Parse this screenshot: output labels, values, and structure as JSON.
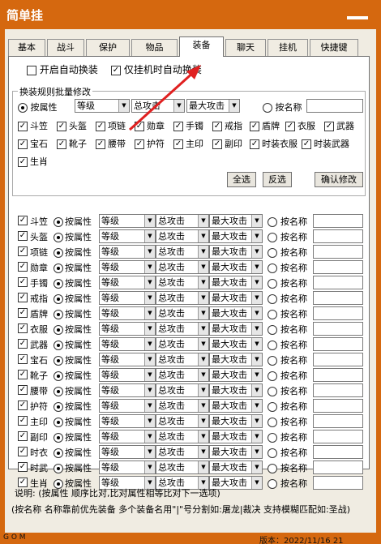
{
  "window": {
    "title": "简单挂"
  },
  "tabs": [
    {
      "label": "基本"
    },
    {
      "label": "战斗"
    },
    {
      "label": "保护"
    },
    {
      "label": "物品"
    },
    {
      "label": "装备"
    },
    {
      "label": "聊天"
    },
    {
      "label": "挂机"
    },
    {
      "label": "快捷键"
    }
  ],
  "options": {
    "auto_swap": {
      "label": "开启自动换装",
      "checked": false
    },
    "swap_on_idle": {
      "label": "仅挂机时自动换装",
      "checked": true
    }
  },
  "batch": {
    "title": "换装规则批量修改",
    "by_attr_label": "按属性",
    "attr_value": "等级",
    "attack_value": "总攻击",
    "max_value": "最大攻击",
    "by_name_label": "按名称",
    "slots_row1": [
      "斗笠",
      "头盔",
      "项链",
      "勋章",
      "手镯",
      "戒指",
      "盾牌",
      "衣服",
      "武器"
    ],
    "slots_row2": [
      "宝石",
      "靴子",
      "腰带",
      "护符",
      "主印",
      "副印",
      "时装衣服",
      "时装武器"
    ],
    "slots_row3": [
      "生肖"
    ],
    "select_all": "全选",
    "invert": "反选",
    "confirm": "确认修改"
  },
  "rules": {
    "by_attr_label": "按属性",
    "by_name_label": "按名称",
    "attr_value": "等级",
    "attack_value": "总攻击",
    "max_value": "最大攻击",
    "items": [
      "斗笠",
      "头盔",
      "项链",
      "勋章",
      "手镯",
      "戒指",
      "盾牌",
      "衣服",
      "武器",
      "宝石",
      "靴子",
      "腰带",
      "护符",
      "主印",
      "副印",
      "时衣",
      "时武",
      "生肖"
    ]
  },
  "notes": {
    "line1": "说明:  (按属性 顺序比对,比对属性相等比对下一选项)",
    "line2": "(按名称 名称靠前优先装备 多个装备名用\"|\"号分割如:屠龙|裁决 支持模糊匹配如:圣战)"
  },
  "status": {
    "left": "G O M",
    "version": "版本：2022/11/16 21"
  },
  "colors": {
    "frame": "#d5680f",
    "client": "#f0ece2",
    "annotation_arrow": "#e02020"
  }
}
